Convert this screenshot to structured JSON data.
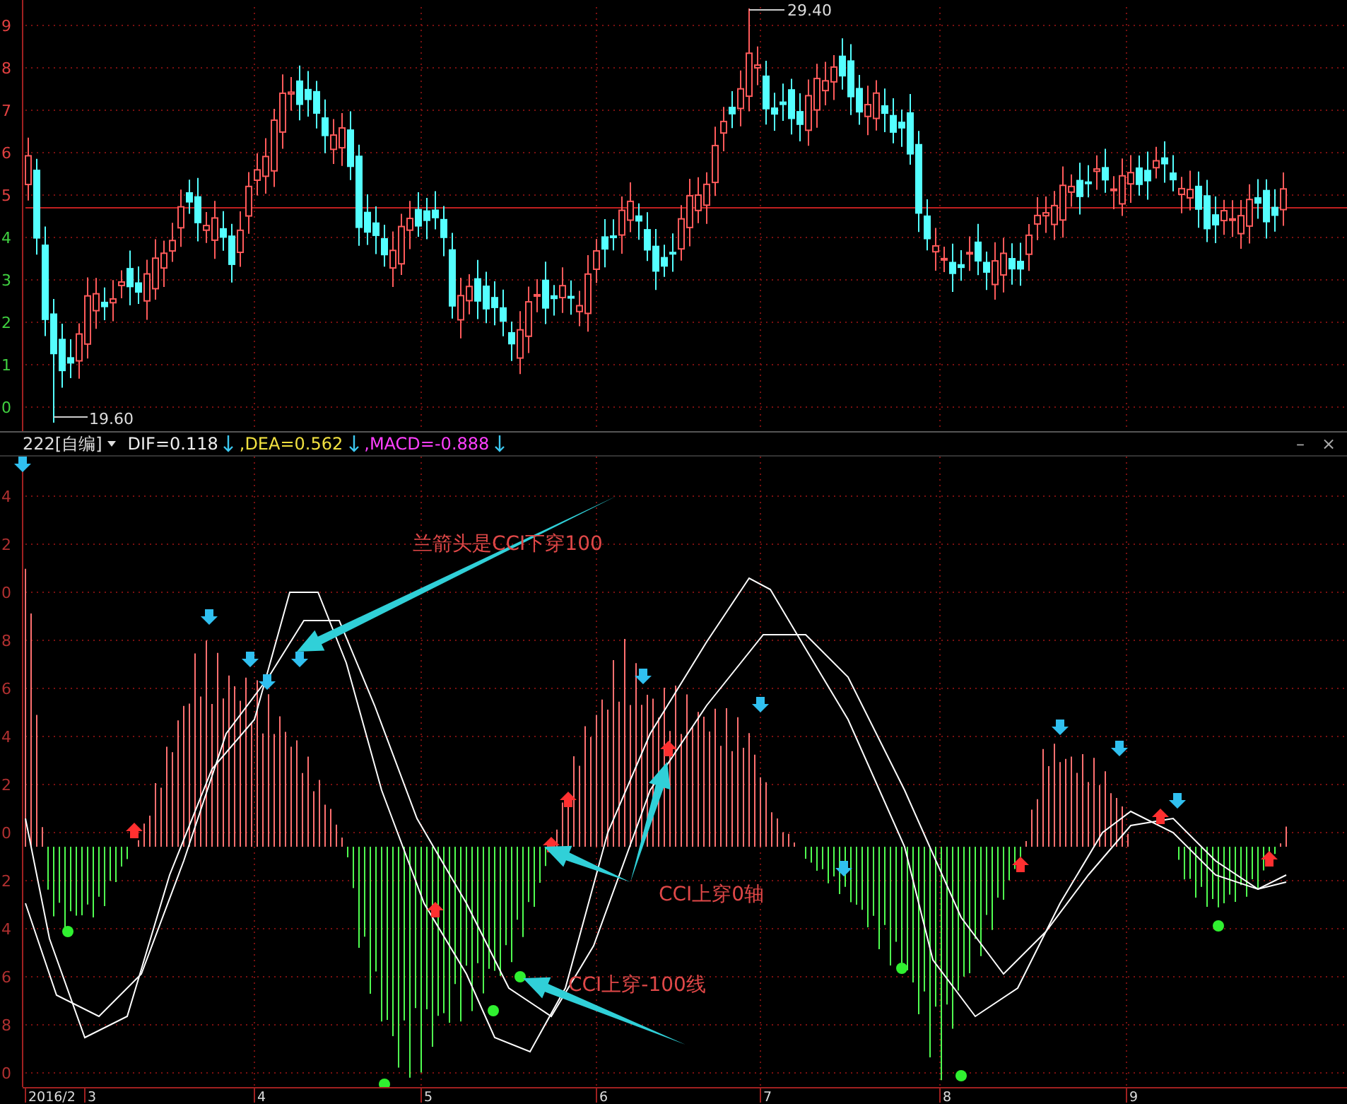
{
  "price_panel": {
    "axis_labels": [
      {
        "text": "9",
        "color": "#e04040"
      },
      {
        "text": "8",
        "color": "#e04040"
      },
      {
        "text": "7",
        "color": "#e04040"
      },
      {
        "text": "6",
        "color": "#e04040"
      },
      {
        "text": "5",
        "color": "#e04040"
      },
      {
        "text": "4",
        "color": "#40d040"
      },
      {
        "text": "3",
        "color": "#40d040"
      },
      {
        "text": "2",
        "color": "#40d040"
      },
      {
        "text": "1",
        "color": "#40d040"
      },
      {
        "text": "0",
        "color": "#40d040"
      }
    ],
    "high_label": "29.40",
    "low_label": "19.60"
  },
  "indicator_bar": {
    "name": "222[自编]",
    "dif": "DIF=0.118",
    "dea": ",DEA=0.562",
    "macd": ",MACD=-0.888",
    "minimize": "–",
    "close": "×"
  },
  "indicator_panel": {
    "axis_labels": [
      "4",
      "2",
      "0",
      "8",
      "6",
      "4",
      "2",
      "0",
      "2",
      "4",
      "6",
      "8",
      "0"
    ],
    "annotations": [
      "兰箭头是CCI下穿100",
      "CCI上穿0轴",
      "CCI上穿-100线"
    ]
  },
  "date_axis": [
    "2016/2",
    "3",
    "4",
    "5",
    "6",
    "7",
    "8",
    "9"
  ]
}
